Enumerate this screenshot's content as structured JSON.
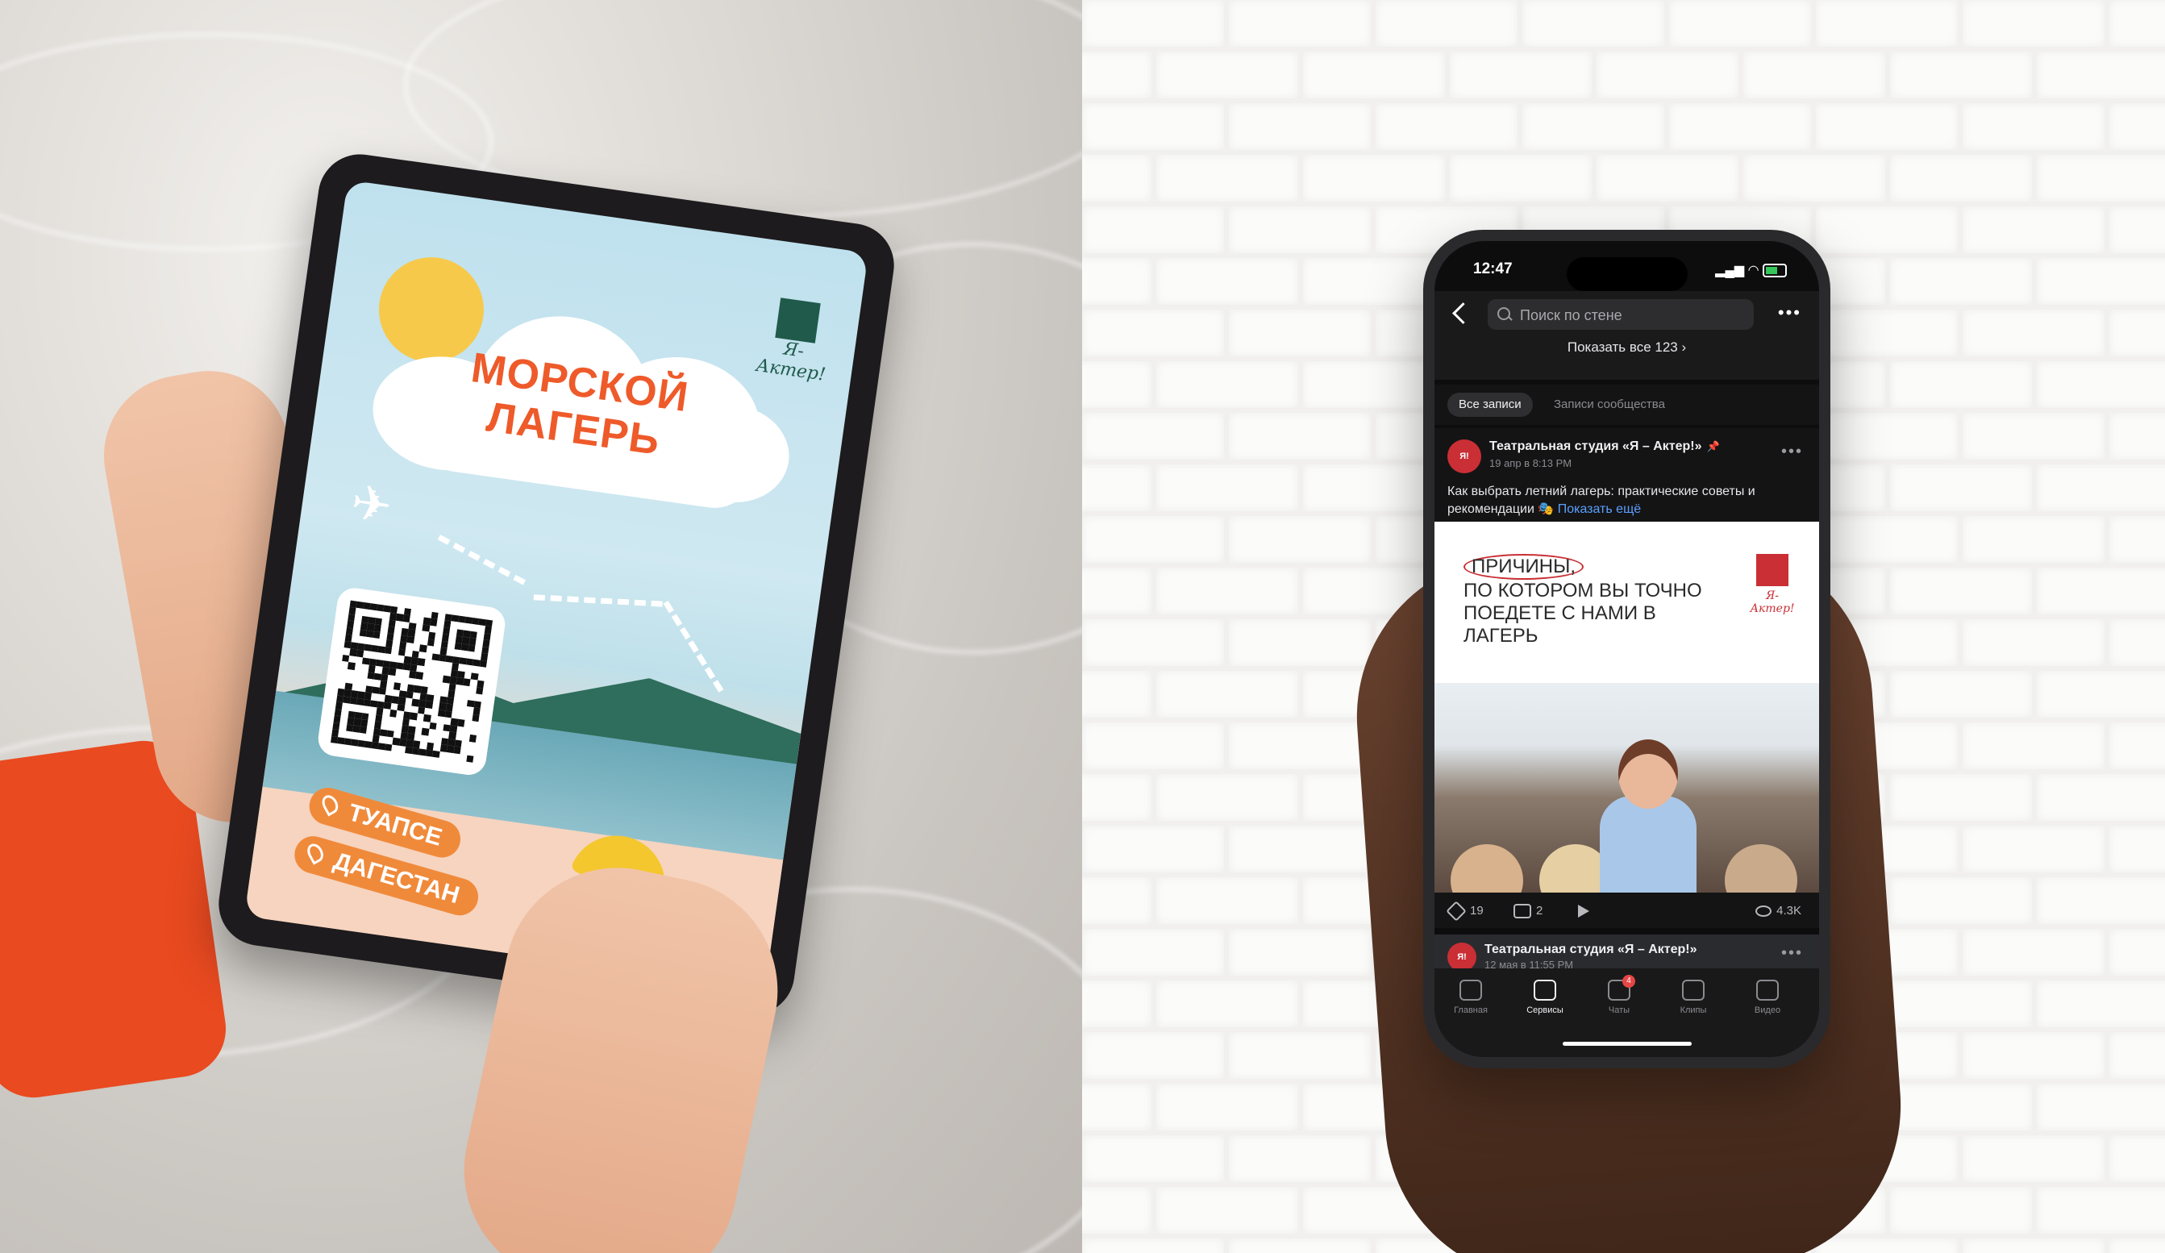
{
  "tablet": {
    "title_line1": "МОРСКОЙ",
    "title_line2": "ЛАГЕРЬ",
    "logo_text": "Я-Актер!",
    "locations": [
      "ТУАПСЕ",
      "ДАГЕСТАН"
    ]
  },
  "phone": {
    "status": {
      "time": "12:47"
    },
    "search": {
      "placeholder": "Поиск по стене"
    },
    "show_all": "Показать все 123 ›",
    "tabs": [
      "Все записи",
      "Записи сообщества"
    ],
    "post": {
      "author": "Театральная студия «Я – Актер!»",
      "date": "19 апр в 8:13 PM",
      "text": "Как выбрать летний лагерь: практические советы и рекомендации 🎭",
      "show_more": "Показать ещё",
      "image_headline_circled": "ПРИЧИНЫ,",
      "image_headline_rest": "ПО КОТОРОМ ВЫ ТОЧНО ПОЕДЕТЕ С НАМИ В ЛАГЕРЬ",
      "image_logo_text": "Я-Актер!",
      "likes": "19",
      "comments": "2",
      "views": "4.3K"
    },
    "post2": {
      "author": "Театральная студия «Я – Актер!»",
      "date": "12 мая в 11:55 PM"
    },
    "tabbar": [
      {
        "label": "Главная",
        "icon": "home-icon"
      },
      {
        "label": "Сервисы",
        "icon": "services-icon"
      },
      {
        "label": "Чаты",
        "icon": "chat-icon",
        "badge": "4"
      },
      {
        "label": "Клипы",
        "icon": "clips-icon"
      },
      {
        "label": "Видео",
        "icon": "video-icon"
      }
    ]
  }
}
